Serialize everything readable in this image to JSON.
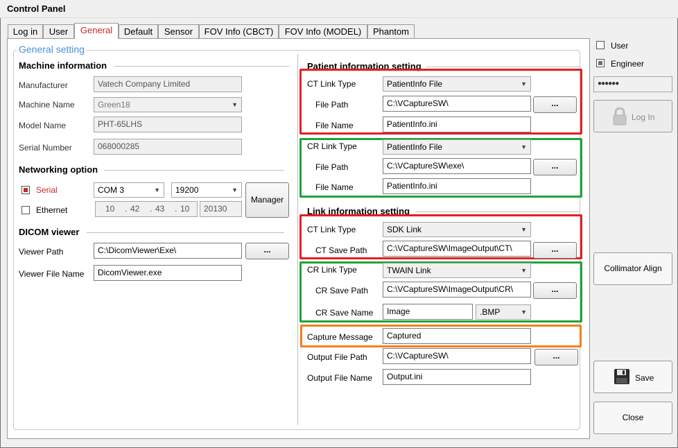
{
  "window": {
    "title": "Control Panel"
  },
  "tabs": [
    "Log in",
    "User",
    "General",
    "Default",
    "Sensor",
    "FOV Info (CBCT)",
    "FOV Info (MODEL)",
    "Phantom"
  ],
  "general_group": "General setting",
  "machine": {
    "heading": "Machine information",
    "manufacturer_label": "Manufacturer",
    "manufacturer": "Vatech Company Limited",
    "machine_name_label": "Machine Name",
    "machine_name": "Green18",
    "model_name_label": "Model Name",
    "model_name": "PHT-65LHS",
    "serial_label": "Serial Number",
    "serial": "068000285"
  },
  "networking": {
    "heading": "Networking option",
    "serial_label": "Serial",
    "serial_checked": true,
    "com_port": "COM 3",
    "baud": "19200",
    "manager_button": "Manager",
    "ethernet_label": "Ethernet",
    "ethernet_checked": false,
    "ip": [
      "10",
      "42",
      "43",
      "10"
    ],
    "port": "20130"
  },
  "dicom": {
    "heading": "DICOM viewer",
    "path_label": "Viewer Path",
    "path": "C:\\DicomViewer\\Exe\\",
    "file_label": "Viewer File Name",
    "file": "DicomViewer.exe",
    "browse": "..."
  },
  "patient": {
    "heading": "Patient information setting",
    "ct_type_label": "CT Link Type",
    "ct_type": "PatientInfo File",
    "ct_path_label": "File Path",
    "ct_path": "C:\\VCaptureSW\\",
    "ct_name_label": "File Name",
    "ct_name": "PatientInfo.ini",
    "cr_type_label": "CR Link Type",
    "cr_type": "PatientInfo File",
    "cr_path_label": "File Path",
    "cr_path": "C:\\VCaptureSW\\exe\\",
    "cr_name_label": "File Name",
    "cr_name": "PatientInfo.ini",
    "browse": "..."
  },
  "link": {
    "heading": "Link information setting",
    "ct_type_label": "CT Link Type",
    "ct_type": "SDK Link",
    "ct_save_label": "CT Save Path",
    "ct_save": "C:\\VCaptureSW\\ImageOutput\\CT\\",
    "cr_type_label": "CR Link Type",
    "cr_type": "TWAIN Link",
    "cr_save_label": "CR Save Path",
    "cr_save": "C:\\VCaptureSW\\ImageOutput\\CR\\",
    "cr_name_label": "CR Save Name",
    "cr_name": "Image",
    "cr_ext": ".BMP",
    "capture_label": "Capture Message",
    "capture": "Captured",
    "out_path_label": "Output File Path",
    "out_path": "C:\\VCaptureSW\\",
    "out_name_label": "Output File Name",
    "out_name": "Output.ini",
    "browse": "..."
  },
  "side": {
    "user_label": "User",
    "user_checked": false,
    "engineer_label": "Engineer",
    "engineer_checked": true,
    "password": "●●●●●●",
    "login": "Log In",
    "collimator": "Collimator Align",
    "save": "Save",
    "close": "Close"
  },
  "colors": {
    "red": "#e31e24",
    "green": "#1fa33a",
    "orange": "#f08020",
    "active_tab": "#c62828",
    "group_title": "#4a8fd6"
  }
}
